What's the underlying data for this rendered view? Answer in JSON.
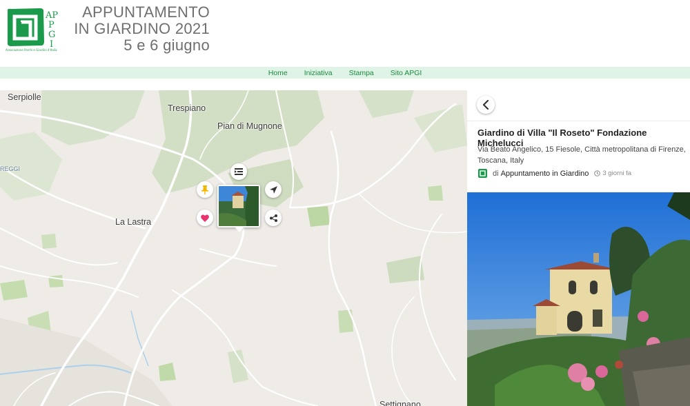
{
  "header": {
    "logo_text": "APGI",
    "logo_org": "Associazione Parchi e Giardini d'Italia",
    "title_line1": "APPUNTAMENTO",
    "title_line2": "IN GIARDINO 2021",
    "title_line3": "5 e 6 giugno"
  },
  "nav": {
    "items": [
      "Home",
      "Iniziativa",
      "Stampa",
      "Sito APGI"
    ]
  },
  "map": {
    "places": {
      "serpiolle": "Serpiolle",
      "trespiano": "Trespiano",
      "pian_di_mugnone": "Pian di Mugnone",
      "la_lastra": "La Lastra",
      "careggi": "REGGI",
      "settignano": "Settignano"
    },
    "marker_actions": [
      "list-icon",
      "pin-icon",
      "navigate-icon",
      "heart-icon",
      "share-icon"
    ]
  },
  "panel": {
    "title": "Giardino di Villa \"Il Roseto\" Fondazione Michelucci",
    "address": "Via Beato Angelico, 15 Fiesole, Città metropolitana di Firenze, Toscana, Italy",
    "by_label": "di",
    "author": "Appuntamento in Giardino",
    "time_ago": "3 giorni fa"
  },
  "colors": {
    "brand_green": "#1a9a4a",
    "nav_bg": "#dff3e6",
    "heart": "#e8336d",
    "pin": "#f2b705"
  }
}
